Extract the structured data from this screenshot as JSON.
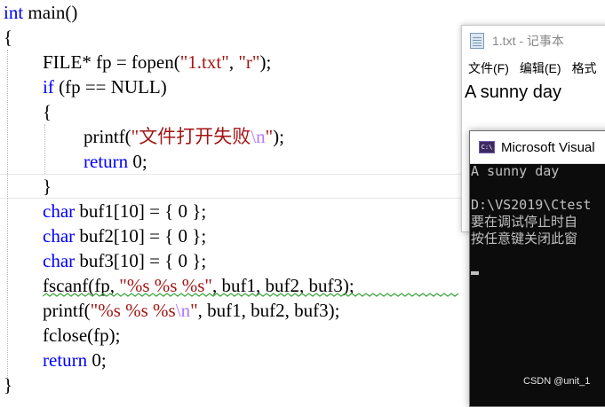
{
  "code": {
    "lines": [
      [
        "int",
        " main()"
      ],
      [
        "{"
      ],
      [
        "FILE* fp = fopen(",
        "\"1.txt\"",
        ", ",
        "\"r\"",
        ");"
      ],
      [
        "if",
        " (fp == NULL)"
      ],
      [
        "{"
      ],
      [
        "printf(",
        "\"文件打开失败",
        "\\n",
        "\"",
        ");"
      ],
      [
        "return",
        " 0;"
      ],
      [
        "}"
      ],
      [
        "char",
        " buf1[10] = { 0 };"
      ],
      [
        "char",
        " buf2[10] = { 0 };"
      ],
      [
        "char",
        " buf3[10] = { 0 };"
      ],
      [
        "fscanf(fp, ",
        "\"%s %s %s\"",
        ", buf1, buf2, buf3);"
      ],
      [
        "printf(",
        "\"%s %s %s",
        "\\n",
        "\"",
        ", buf1, buf2, buf3);"
      ],
      [
        "fclose(fp);"
      ],
      [
        "return",
        " 0;"
      ],
      [
        "}"
      ]
    ]
  },
  "notepad": {
    "title": "1.txt - 记事本",
    "menu": [
      "文件(F)",
      "编辑(E)",
      "格式"
    ],
    "content": "A sunny day"
  },
  "console": {
    "title": "Microsoft Visual",
    "icon_text": "C:\\",
    "lines": [
      "A sunny day",
      "",
      "D:\\VS2019\\Ctest",
      "要在调试停止时自",
      "按任意键关闭此窗"
    ]
  },
  "watermark": "CSDN @unit_1",
  "colors": {
    "keyword": "#0000ff",
    "string": "#a31515",
    "escape": "#b776fb",
    "console_bg": "#0c0c0c",
    "console_text": "#c0c0c0"
  }
}
